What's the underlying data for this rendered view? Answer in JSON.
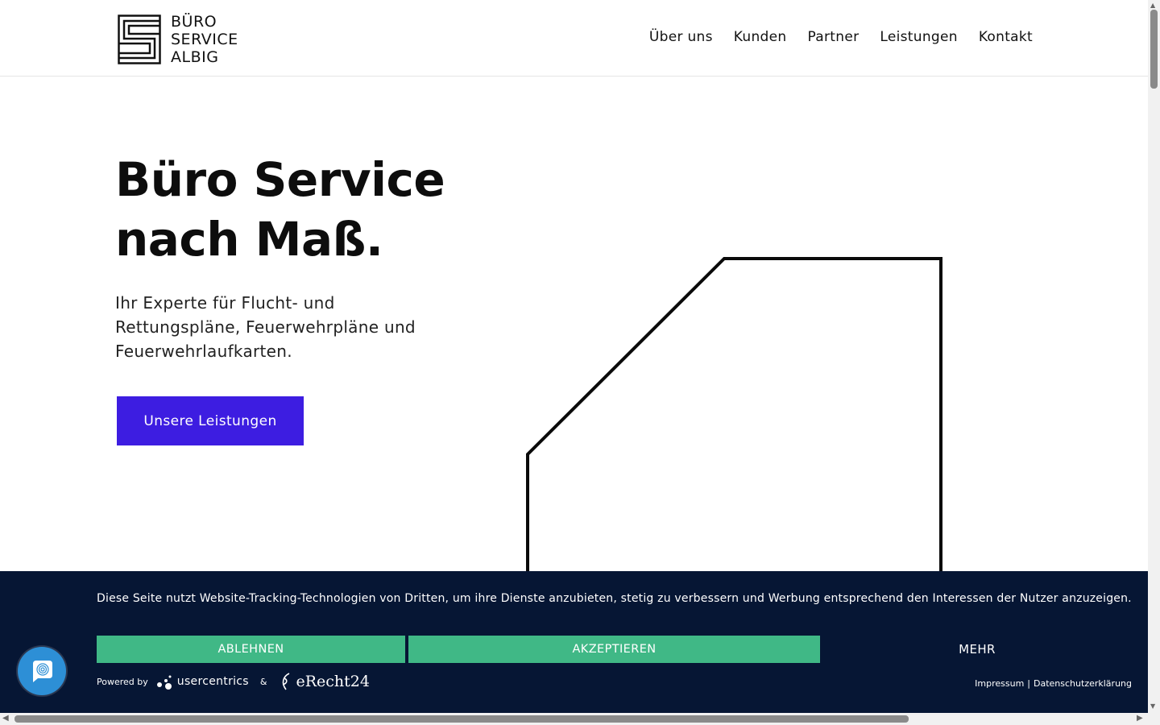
{
  "logo": {
    "line1": "BÜRO",
    "line2": "SERVICE",
    "line3": "ALBIG"
  },
  "nav": {
    "items": [
      {
        "label": "Über uns"
      },
      {
        "label": "Kunden"
      },
      {
        "label": "Partner"
      },
      {
        "label": "Leistungen"
      },
      {
        "label": "Kontakt"
      }
    ]
  },
  "hero": {
    "title_line1": "Büro Service",
    "title_line2": "nach Maß.",
    "subtitle_line1": "Ihr Experte für Flucht- und",
    "subtitle_line2": "Rettungspläne, Feuerwehrpläne und",
    "subtitle_line3": "Feuerwehrlaufkarten.",
    "cta_label": "Unsere Leistungen",
    "cta_color": "#3d1de1"
  },
  "cookie_banner": {
    "text": "Diese Seite nutzt Website-Tracking-Technologien von Dritten, um ihre Dienste anzubieten, stetig zu verbessern und Werbung entsprechend den Interessen der Nutzer anzuzeigen.",
    "decline_label": "ABLEHNEN",
    "accept_label": "AKZEPTIEREN",
    "more_label": "MEHR",
    "powered_by": "Powered by",
    "usercentrics": "usercentrics",
    "ampersand": "&",
    "erecht": "eRecht24",
    "impressum": "Impressum",
    "separator": "|",
    "privacy": "Datenschutzerklärung",
    "background_color": "#061634",
    "button_color": "#40b886"
  },
  "icons": {
    "fingerprint": "fingerprint-icon"
  }
}
